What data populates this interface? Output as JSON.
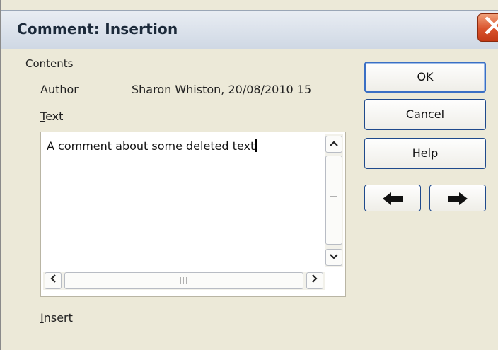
{
  "dialog": {
    "title": "Comment: Insertion"
  },
  "contents": {
    "group_label": "Contents",
    "author_label": "Author",
    "author_value": "Sharon Whiston, 20/08/2010 15",
    "text_label_first": "T",
    "text_label_rest": "ext",
    "comment_text": "A comment about some deleted text",
    "insert_label_first": "I",
    "insert_label_rest": "nsert"
  },
  "buttons": {
    "ok": "OK",
    "cancel": "Cancel",
    "help_first": "H",
    "help_rest": "elp"
  },
  "icons": {
    "close": "close-icon",
    "previous": "arrow-left-icon",
    "next": "arrow-right-icon"
  }
}
